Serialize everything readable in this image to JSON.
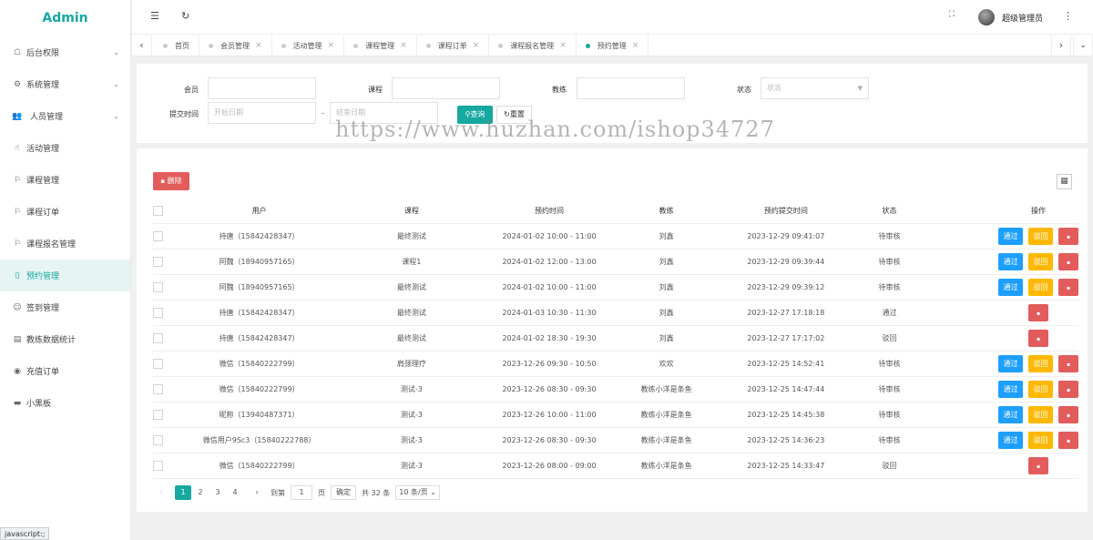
{
  "app": {
    "logo": "Admin"
  },
  "sidebar": {
    "items": [
      {
        "label": "后台权限",
        "icon": "user-icon",
        "glyph": "☖",
        "chevron": true
      },
      {
        "label": "系统管理",
        "icon": "gear-icon",
        "glyph": "⚙",
        "chevron": true
      },
      {
        "label": "人员管理",
        "icon": "users-icon",
        "glyph": "👥",
        "chevron": true
      },
      {
        "label": "活动管理",
        "icon": "hand-icon",
        "glyph": "☝"
      },
      {
        "label": "课程管理",
        "icon": "flag-icon",
        "glyph": "⚐"
      },
      {
        "label": "课程订单",
        "icon": "flag-icon",
        "glyph": "⚐"
      },
      {
        "label": "课程报名管理",
        "icon": "flag-icon",
        "glyph": "⚐"
      },
      {
        "label": "预约管理",
        "icon": "phone-icon",
        "glyph": "▯",
        "active": true
      },
      {
        "label": "签到管理",
        "icon": "smile-icon",
        "glyph": "☺"
      },
      {
        "label": "教练数据统计",
        "icon": "doc-icon",
        "glyph": "▤"
      },
      {
        "label": "充值订单",
        "icon": "circle-dot-icon",
        "glyph": "◉"
      },
      {
        "label": "小黑板",
        "icon": "chat-icon",
        "glyph": "▬"
      }
    ]
  },
  "header": {
    "username": "超级管理员"
  },
  "tabs": [
    {
      "label": "首页"
    },
    {
      "label": "会员管理"
    },
    {
      "label": "活动管理"
    },
    {
      "label": "课程管理"
    },
    {
      "label": "课程订单"
    },
    {
      "label": "课程报名管理"
    },
    {
      "label": "预约管理",
      "active": true
    }
  ],
  "filter": {
    "member_label": "会员",
    "course_label": "课程",
    "coach_label": "教练",
    "status_label": "状态",
    "status_placeholder": "状态",
    "submit_time_label": "提交时间",
    "start_placeholder": "开始日期",
    "end_placeholder": "结束日期",
    "range_sep": "-",
    "search_label": "查询",
    "reset_label": "重置"
  },
  "toolbar": {
    "delete_label": "删除"
  },
  "table": {
    "headers": [
      "用户",
      "课程",
      "预约时间",
      "教练",
      "预约提交时间",
      "状态",
      "操作"
    ],
    "rows": [
      {
        "user": "持唐（15842428347）",
        "course": "最终测试",
        "time": "2024-01-02 10:00 - 11:00",
        "coach": "刘鑫",
        "submitted": "2023-12-29 09:41:07",
        "status": "待审核",
        "actions": [
          "pass",
          "reject",
          "delete"
        ]
      },
      {
        "user": "阿魏（18940957165）",
        "course": "课程1",
        "time": "2024-01-02 12:00 - 13:00",
        "coach": "刘鑫",
        "submitted": "2023-12-29 09:39:44",
        "status": "待审核",
        "actions": [
          "pass",
          "reject",
          "delete"
        ]
      },
      {
        "user": "阿魏（18940957165）",
        "course": "最终测试",
        "time": "2024-01-02 10:00 - 11:00",
        "coach": "刘鑫",
        "submitted": "2023-12-29 09:39:12",
        "status": "待审核",
        "actions": [
          "pass",
          "reject",
          "delete"
        ]
      },
      {
        "user": "持唐（15842428347）",
        "course": "最终测试",
        "time": "2024-01-03 10:30 - 11:30",
        "coach": "刘鑫",
        "submitted": "2023-12-27 17:18:18",
        "status": "通过",
        "actions": [
          "delete"
        ]
      },
      {
        "user": "持唐（15842428347）",
        "course": "最终测试",
        "time": "2024-01-02 18:30 - 19:30",
        "coach": "刘鑫",
        "submitted": "2023-12-27 17:17:02",
        "status": "驳回",
        "actions": [
          "delete"
        ]
      },
      {
        "user": "微信（15840222799）",
        "course": "肩颈理疗",
        "time": "2023-12-26 09:30 - 10:50",
        "coach": "欢欢",
        "submitted": "2023-12-25 14:52:41",
        "status": "待审核",
        "actions": [
          "pass",
          "reject",
          "delete"
        ]
      },
      {
        "user": "微信（15840222799）",
        "course": "测试-3",
        "time": "2023-12-26 08:30 - 09:30",
        "coach": "教练小洋是条鱼",
        "submitted": "2023-12-25 14:47:44",
        "status": "待审核",
        "actions": [
          "pass",
          "reject",
          "delete"
        ]
      },
      {
        "user": "昵称（13940487371）",
        "course": "测试-3",
        "time": "2023-12-26 10:00 - 11:00",
        "coach": "教练小洋是条鱼",
        "submitted": "2023-12-25 14:45:38",
        "status": "待审核",
        "actions": [
          "pass",
          "reject",
          "delete"
        ]
      },
      {
        "user": "微信用户9Sc3（15840222788）",
        "course": "测试-3",
        "time": "2023-12-26 08:30 - 09:30",
        "coach": "教练小洋是条鱼",
        "submitted": "2023-12-25 14:36:23",
        "status": "待审核",
        "actions": [
          "pass",
          "reject",
          "delete"
        ]
      },
      {
        "user": "微信（15840222799）",
        "course": "测试-3",
        "time": "2023-12-26 08:00 - 09:00",
        "coach": "教练小洋是条鱼",
        "submitted": "2023-12-25 14:33:47",
        "status": "驳回",
        "actions": [
          "delete"
        ]
      }
    ],
    "pass_label": "通过",
    "reject_label": "驳回",
    "delete_glyph": "🗑"
  },
  "pagination": {
    "pages": [
      "1",
      "2",
      "3",
      "4"
    ],
    "current": "1",
    "goto_label": "到第",
    "goto_value": "1",
    "page_unit": "页",
    "confirm_label": "确定",
    "total_label": "共 32 条",
    "page_size_label": "10 条/页"
  },
  "watermark": "https://www.huzhan.com/ishop34727",
  "statusbar": "javascript:;",
  "colors": {
    "accent": "#17a8a0",
    "pass": "#1e9fff",
    "reject": "#ffb800",
    "delete": "#e25c5c"
  }
}
